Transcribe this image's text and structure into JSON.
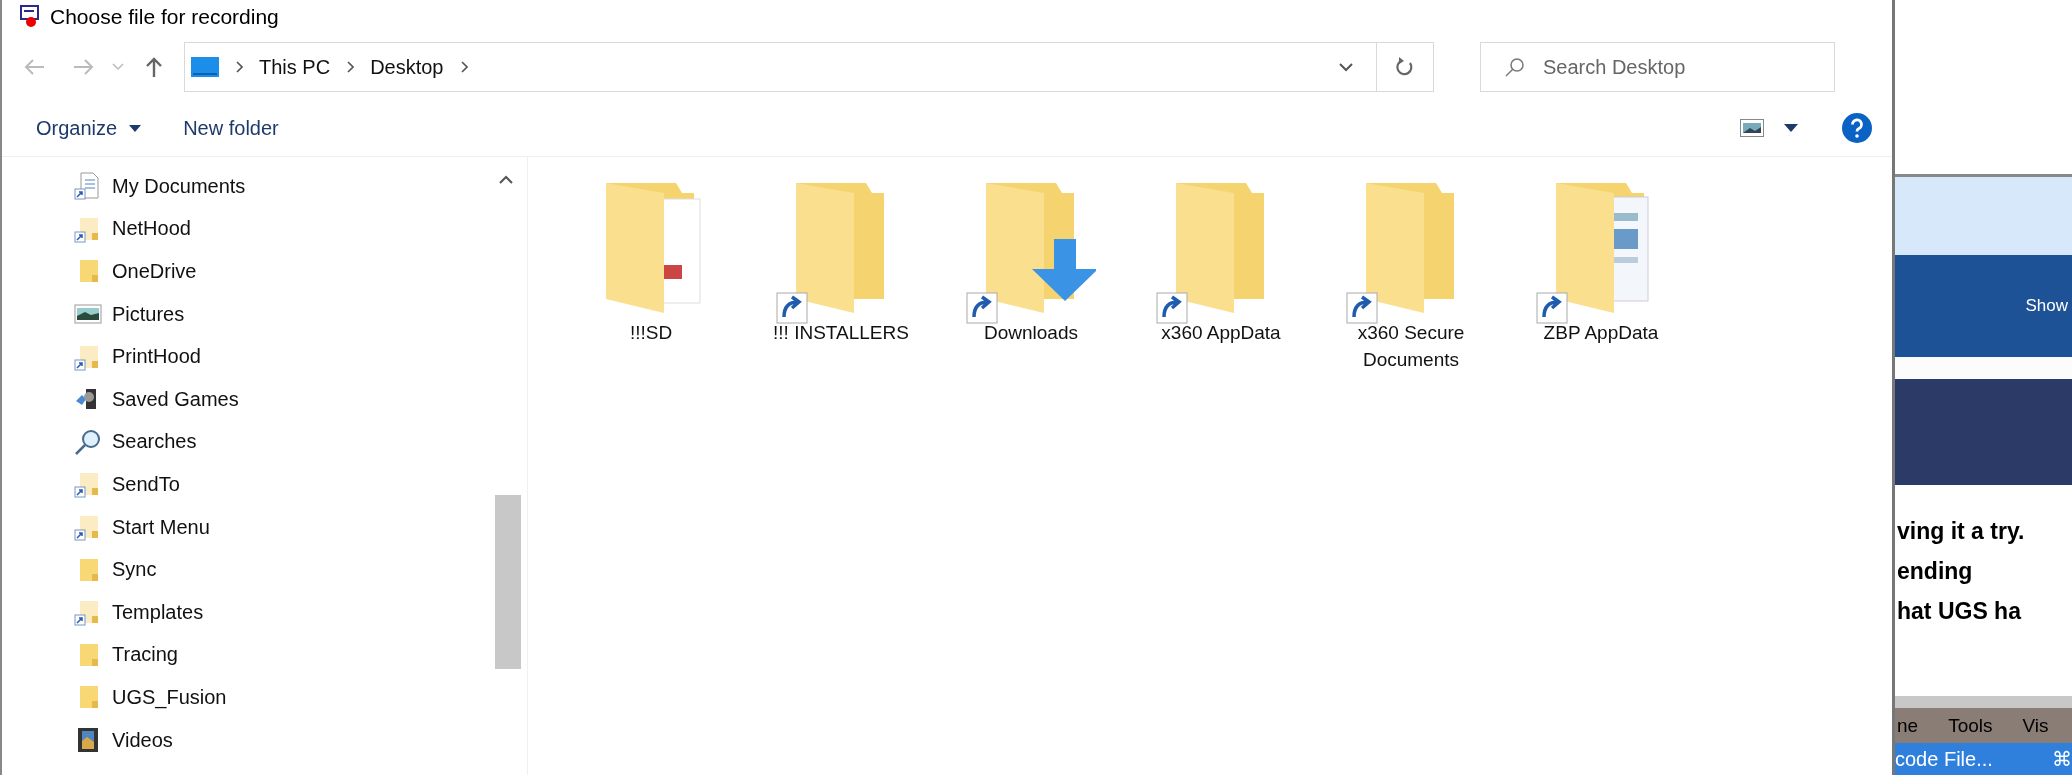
{
  "window": {
    "title": "Choose file for recording"
  },
  "address": {
    "path": [
      "This PC",
      "Desktop"
    ]
  },
  "search": {
    "placeholder": "Search Desktop"
  },
  "toolbar": {
    "organize": "Organize",
    "new_folder": "New folder"
  },
  "sidebar": {
    "items": [
      {
        "label": "My Documents",
        "kind": "documents",
        "shortcut": true
      },
      {
        "label": "NetHood",
        "kind": "folder",
        "shortcut": true
      },
      {
        "label": "OneDrive",
        "kind": "folder",
        "shortcut": false
      },
      {
        "label": "Pictures",
        "kind": "pictures",
        "shortcut": false
      },
      {
        "label": "PrintHood",
        "kind": "folder",
        "shortcut": true
      },
      {
        "label": "Saved Games",
        "kind": "games",
        "shortcut": false
      },
      {
        "label": "Searches",
        "kind": "search",
        "shortcut": false
      },
      {
        "label": "SendTo",
        "kind": "folder",
        "shortcut": true
      },
      {
        "label": "Start Menu",
        "kind": "folder",
        "shortcut": true
      },
      {
        "label": "Sync",
        "kind": "folder",
        "shortcut": false
      },
      {
        "label": "Templates",
        "kind": "folder",
        "shortcut": true
      },
      {
        "label": "Tracing",
        "kind": "folder",
        "shortcut": false
      },
      {
        "label": "UGS_Fusion",
        "kind": "folder",
        "shortcut": false
      },
      {
        "label": "Videos",
        "kind": "videos",
        "shortcut": false
      }
    ]
  },
  "files": [
    {
      "label": "!!!SD",
      "kind": "photo",
      "shortcut": false
    },
    {
      "label": "!!! INSTALLERS",
      "kind": "plain",
      "shortcut": true
    },
    {
      "label": "Downloads",
      "kind": "download",
      "shortcut": true
    },
    {
      "label": "x360 AppData",
      "kind": "plain",
      "shortcut": true
    },
    {
      "label": "x360 Secure Documents",
      "kind": "plain",
      "shortcut": true
    },
    {
      "label": "ZBP AppData",
      "kind": "documents",
      "shortcut": true
    }
  ],
  "background_page": {
    "banner_text": "Show",
    "body_lines": [
      "ving it a try.",
      "ending",
      "hat UGS ha"
    ],
    "menu": [
      "ne",
      "Tools",
      "Vis"
    ],
    "menu_item": "code File...",
    "shortcut_key": "⌘"
  }
}
